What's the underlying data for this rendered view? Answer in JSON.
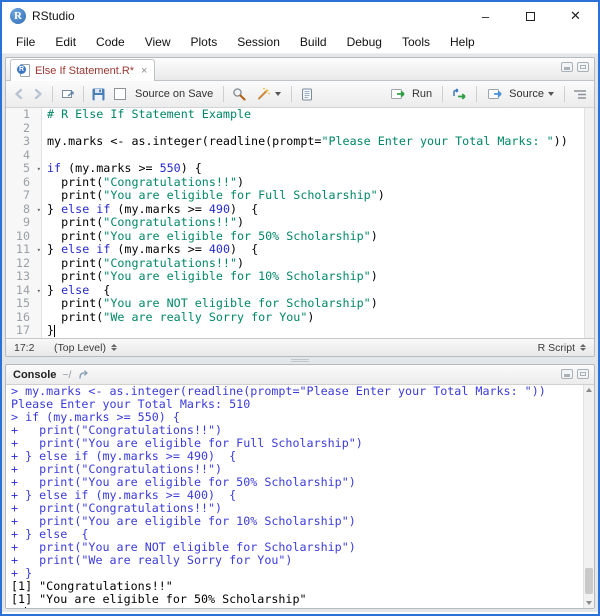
{
  "window": {
    "title": "RStudio",
    "controls": {
      "minimize": "–",
      "close": "✕"
    }
  },
  "menubar": {
    "items": [
      "File",
      "Edit",
      "Code",
      "View",
      "Plots",
      "Session",
      "Build",
      "Debug",
      "Tools",
      "Help"
    ]
  },
  "source_pane": {
    "tab": {
      "title": "Else If Statement.R*",
      "close_glyph": "×"
    },
    "toolbar": {
      "source_on_save_label": "Source on Save",
      "source_on_save_checked": false,
      "run_label": "Run",
      "source_label": "Source"
    },
    "status": {
      "cursor_position": "17:2",
      "scope": "(Top Level)",
      "file_type": "R Script"
    }
  },
  "editor": {
    "lines": [
      {
        "n": 1,
        "fold": false,
        "seg": [
          {
            "c": "com",
            "t": "# R Else If Statement Example"
          }
        ]
      },
      {
        "n": 2,
        "fold": false,
        "seg": []
      },
      {
        "n": 3,
        "fold": false,
        "seg": [
          {
            "c": "txt",
            "t": "my.marks <- as.integer(readline(prompt="
          },
          {
            "c": "str",
            "t": "\"Please Enter your Total Marks: \""
          },
          {
            "c": "txt",
            "t": "))"
          }
        ]
      },
      {
        "n": 4,
        "fold": false,
        "seg": []
      },
      {
        "n": 5,
        "fold": true,
        "seg": [
          {
            "c": "kw",
            "t": "if"
          },
          {
            "c": "txt",
            "t": " (my.marks >= "
          },
          {
            "c": "num",
            "t": "550"
          },
          {
            "c": "txt",
            "t": ") {"
          }
        ]
      },
      {
        "n": 6,
        "fold": false,
        "seg": [
          {
            "c": "txt",
            "t": "  print("
          },
          {
            "c": "str",
            "t": "\"Congratulations!!\""
          },
          {
            "c": "txt",
            "t": ")"
          }
        ]
      },
      {
        "n": 7,
        "fold": false,
        "seg": [
          {
            "c": "txt",
            "t": "  print("
          },
          {
            "c": "str",
            "t": "\"You are eligible for Full Scholarship\""
          },
          {
            "c": "txt",
            "t": ")"
          }
        ]
      },
      {
        "n": 8,
        "fold": true,
        "seg": [
          {
            "c": "txt",
            "t": "} "
          },
          {
            "c": "kw",
            "t": "else"
          },
          {
            "c": "txt",
            "t": " "
          },
          {
            "c": "kw",
            "t": "if"
          },
          {
            "c": "txt",
            "t": " (my.marks >= "
          },
          {
            "c": "num",
            "t": "490"
          },
          {
            "c": "txt",
            "t": ")  {"
          }
        ]
      },
      {
        "n": 9,
        "fold": false,
        "seg": [
          {
            "c": "txt",
            "t": "  print("
          },
          {
            "c": "str",
            "t": "\"Congratulations!!\""
          },
          {
            "c": "txt",
            "t": ")"
          }
        ]
      },
      {
        "n": 10,
        "fold": false,
        "seg": [
          {
            "c": "txt",
            "t": "  print("
          },
          {
            "c": "str",
            "t": "\"You are eligible for 50% Scholarship\""
          },
          {
            "c": "txt",
            "t": ")"
          }
        ]
      },
      {
        "n": 11,
        "fold": true,
        "seg": [
          {
            "c": "txt",
            "t": "} "
          },
          {
            "c": "kw",
            "t": "else"
          },
          {
            "c": "txt",
            "t": " "
          },
          {
            "c": "kw",
            "t": "if"
          },
          {
            "c": "txt",
            "t": " (my.marks >= "
          },
          {
            "c": "num",
            "t": "400"
          },
          {
            "c": "txt",
            "t": ")  {"
          }
        ]
      },
      {
        "n": 12,
        "fold": false,
        "seg": [
          {
            "c": "txt",
            "t": "  print("
          },
          {
            "c": "str",
            "t": "\"Congratulations!!\""
          },
          {
            "c": "txt",
            "t": ")"
          }
        ]
      },
      {
        "n": 13,
        "fold": false,
        "seg": [
          {
            "c": "txt",
            "t": "  print("
          },
          {
            "c": "str",
            "t": "\"You are eligible for 10% Scholarship\""
          },
          {
            "c": "txt",
            "t": ")"
          }
        ]
      },
      {
        "n": 14,
        "fold": true,
        "seg": [
          {
            "c": "txt",
            "t": "} "
          },
          {
            "c": "kw",
            "t": "else"
          },
          {
            "c": "txt",
            "t": "  {"
          }
        ]
      },
      {
        "n": 15,
        "fold": false,
        "seg": [
          {
            "c": "txt",
            "t": "  print("
          },
          {
            "c": "str",
            "t": "\"You are NOT eligible for Scholarship\""
          },
          {
            "c": "txt",
            "t": ")"
          }
        ]
      },
      {
        "n": 16,
        "fold": false,
        "seg": [
          {
            "c": "txt",
            "t": "  print("
          },
          {
            "c": "str",
            "t": "\"We are really Sorry for You\""
          },
          {
            "c": "txt",
            "t": ")"
          }
        ]
      },
      {
        "n": 17,
        "fold": false,
        "cursor": true,
        "seg": [
          {
            "c": "txt",
            "t": "}"
          }
        ]
      }
    ]
  },
  "console": {
    "title": "Console",
    "path": "~/",
    "lines": [
      {
        "type": "input",
        "text": "> my.marks <- as.integer(readline(prompt=\"Please Enter your Total Marks: \"))"
      },
      {
        "type": "input",
        "text": "Please Enter your Total Marks: 510"
      },
      {
        "type": "input",
        "text": "> if (my.marks >= 550) {"
      },
      {
        "type": "input",
        "text": "+   print(\"Congratulations!!\")"
      },
      {
        "type": "input",
        "text": "+   print(\"You are eligible for Full Scholarship\")"
      },
      {
        "type": "input",
        "text": "+ } else if (my.marks >= 490)  {"
      },
      {
        "type": "input",
        "text": "+   print(\"Congratulations!!\")"
      },
      {
        "type": "input",
        "text": "+   print(\"You are eligible for 50% Scholarship\")"
      },
      {
        "type": "input",
        "text": "+ } else if (my.marks >= 400)  {"
      },
      {
        "type": "input",
        "text": "+   print(\"Congratulations!!\")"
      },
      {
        "type": "input",
        "text": "+   print(\"You are eligible for 10% Scholarship\")"
      },
      {
        "type": "input",
        "text": "+ } else  {"
      },
      {
        "type": "input",
        "text": "+   print(\"You are NOT eligible for Scholarship\")"
      },
      {
        "type": "input",
        "text": "+   print(\"We are really Sorry for You\")"
      },
      {
        "type": "input",
        "text": "+ }"
      },
      {
        "type": "output",
        "text": "[1] \"Congratulations!!\""
      },
      {
        "type": "output",
        "text": "[1] \"You are eligible for 50% Scholarship\""
      },
      {
        "type": "prompt",
        "text": "> "
      }
    ]
  },
  "colors": {
    "window_border": "#2b71d8",
    "tab_title": "#9c3732",
    "syntax_keyword": "#2429cf",
    "syntax_number": "#2429cf",
    "syntax_string": "#008767",
    "syntax_comment": "#008767",
    "console_input": "#3b3bdb",
    "console_output": "#000000",
    "run_arrow_green": "#2e9e44",
    "source_arrow_blue": "#4a90d9",
    "save_icon_blue": "#4a7ebb"
  }
}
